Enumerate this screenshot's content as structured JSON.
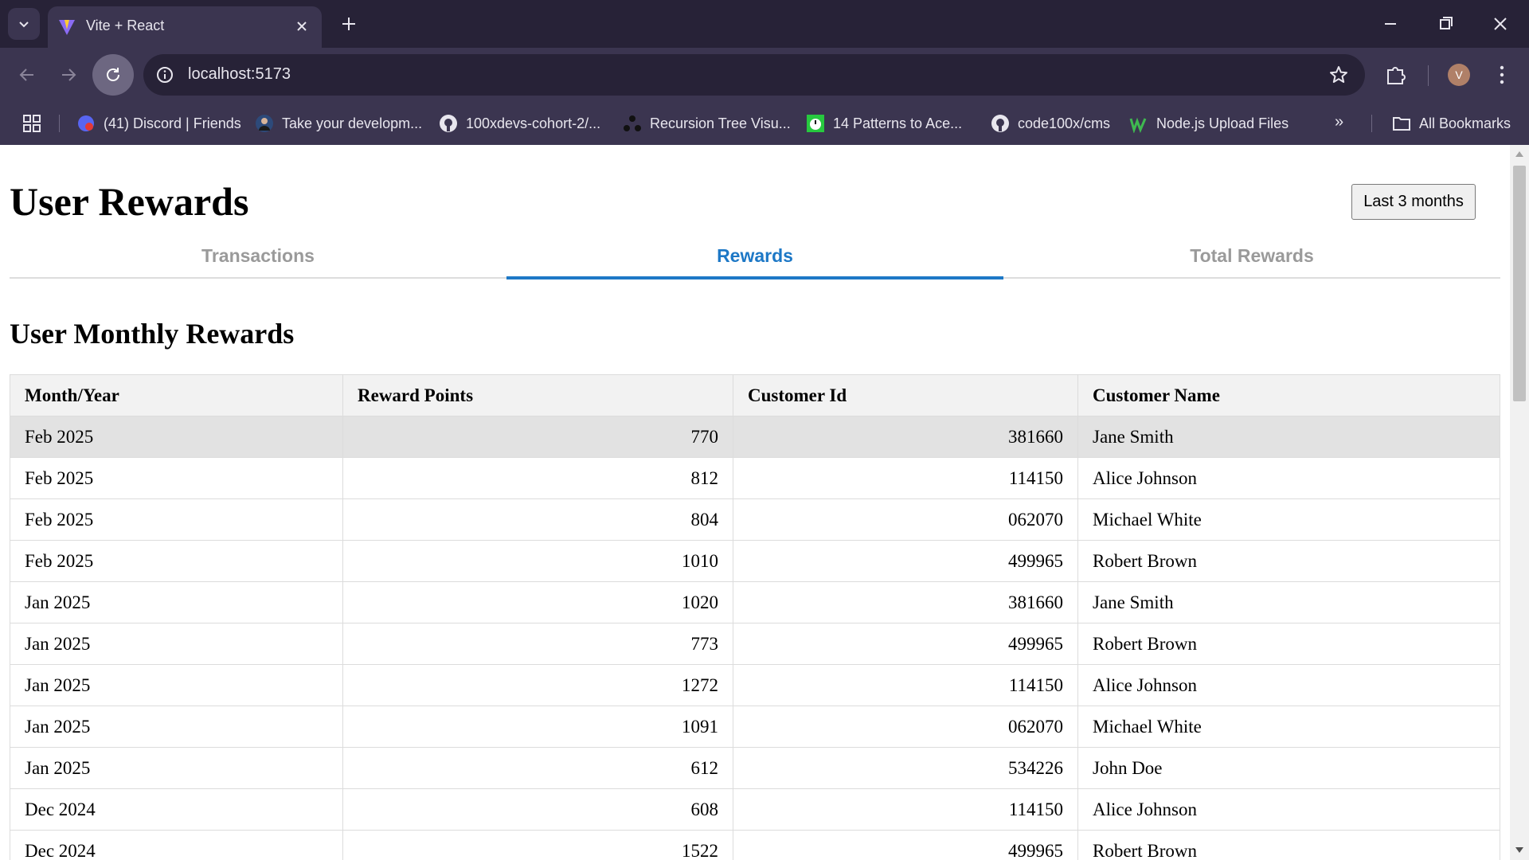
{
  "browser": {
    "tab_title": "Vite + React",
    "url": "localhost:5173",
    "avatar_letter": "V",
    "bookmarks": [
      {
        "label": "(41) Discord | Friends",
        "icon": "discord-icon"
      },
      {
        "label": "Take your developm...",
        "icon": "profile-icon"
      },
      {
        "label": "100xdevs-cohort-2/...",
        "icon": "github-icon"
      },
      {
        "label": "Recursion Tree Visu...",
        "icon": "tree-icon"
      },
      {
        "label": "14 Patterns to Ace...",
        "icon": "timer-icon"
      },
      {
        "label": "code100x/cms",
        "icon": "github-icon"
      },
      {
        "label": "Node.js Upload Files",
        "icon": "w3-icon"
      }
    ],
    "more_bookmarks": "»",
    "all_bookmarks": "All Bookmarks"
  },
  "page": {
    "title": "User Rewards",
    "range_button": "Last 3 months",
    "tabs": [
      {
        "label": "Transactions",
        "active": false
      },
      {
        "label": "Rewards",
        "active": true
      },
      {
        "label": "Total Rewards",
        "active": false
      }
    ],
    "section_title": "User Monthly Rewards",
    "table": {
      "headers": [
        "Month/Year",
        "Reward Points",
        "Customer Id",
        "Customer Name"
      ],
      "rows": [
        [
          "Feb 2025",
          "770",
          "381660",
          "Jane Smith"
        ],
        [
          "Feb 2025",
          "812",
          "114150",
          "Alice Johnson"
        ],
        [
          "Feb 2025",
          "804",
          "062070",
          "Michael White"
        ],
        [
          "Feb 2025",
          "1010",
          "499965",
          "Robert Brown"
        ],
        [
          "Jan 2025",
          "1020",
          "381660",
          "Jane Smith"
        ],
        [
          "Jan 2025",
          "773",
          "499965",
          "Robert Brown"
        ],
        [
          "Jan 2025",
          "1272",
          "114150",
          "Alice Johnson"
        ],
        [
          "Jan 2025",
          "1091",
          "062070",
          "Michael White"
        ],
        [
          "Jan 2025",
          "612",
          "534226",
          "John Doe"
        ],
        [
          "Dec 2024",
          "608",
          "114150",
          "Alice Johnson"
        ],
        [
          "Dec 2024",
          "1522",
          "499965",
          "Robert Brown"
        ]
      ]
    }
  },
  "colors": {
    "chrome_dark": "#272237",
    "chrome_mid": "#3b3550",
    "accent": "#1d78c6"
  }
}
